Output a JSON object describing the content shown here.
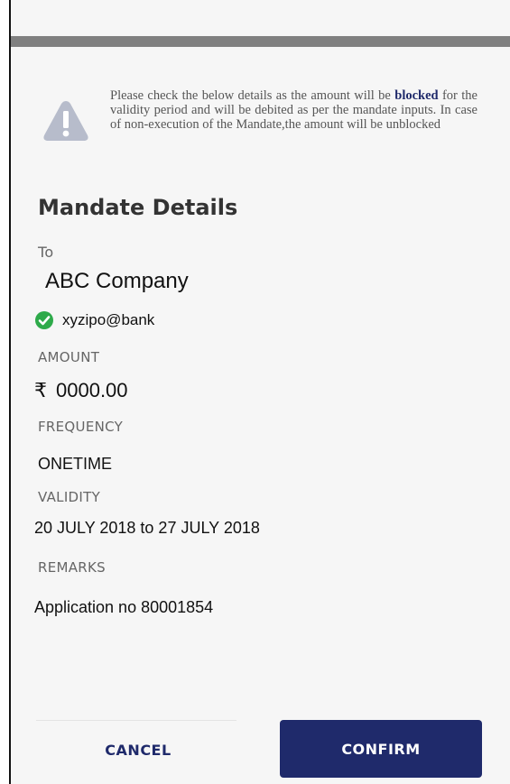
{
  "notice": {
    "text_before": "Please check the below details as the amount will be ",
    "emphasis": "blocked",
    "text_after": " for the validity period and will be debited as per the mandate inputs. In case of non-execution of the Mandate,the amount will be unblocked"
  },
  "mandate": {
    "title": "Mandate Details",
    "to_label": "To",
    "payee_name": "ABC Company",
    "vpa": "xyzipo@bank",
    "amount_label": "AMOUNT",
    "currency_symbol": "₹",
    "amount": "0000.00",
    "frequency_label": "FREQUENCY",
    "frequency": "ONETIME",
    "validity_label": "VALIDITY",
    "validity": "20 JULY 2018 to 27 JULY 2018",
    "remarks_label": "REMARKS",
    "remarks": "Application no 80001854"
  },
  "actions": {
    "cancel_label": "CANCEL",
    "confirm_label": "CONFIRM"
  },
  "colors": {
    "primary": "#1f2a6b",
    "verified": "#2eaa4a",
    "warning_icon": "#b7bccb",
    "top_bar": "#808080"
  },
  "icons": {
    "warning": "warning-triangle-icon",
    "verified": "check-circle-icon"
  }
}
